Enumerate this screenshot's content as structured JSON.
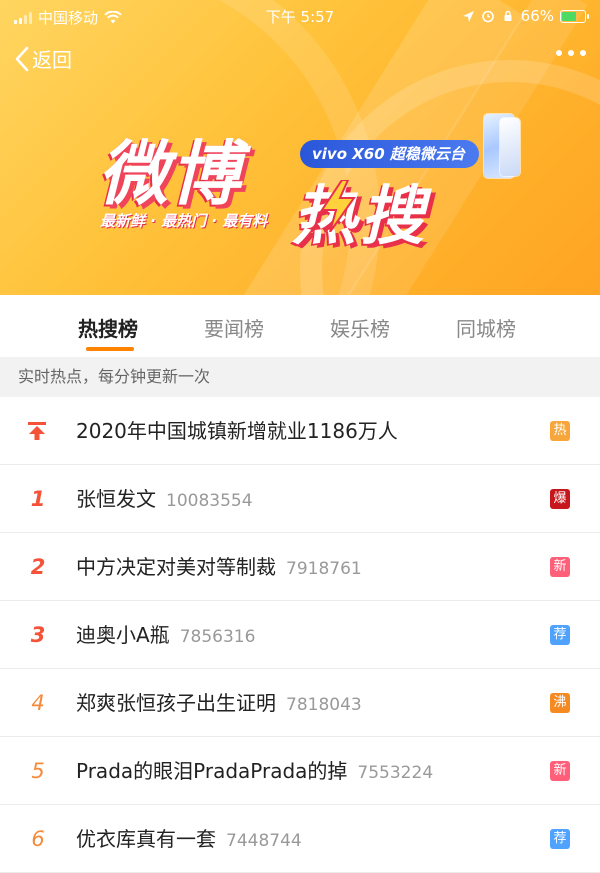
{
  "status_bar": {
    "carrier": "中国移动",
    "time": "下午 5:57",
    "battery": "66%",
    "battery_level": 0.66
  },
  "nav": {
    "back_label": "返回"
  },
  "banner": {
    "title_main": "微博",
    "title_hot": "热搜",
    "sponsor": "vivo X60 超稳微云台",
    "slogan": "最新鲜 · 最热门 · 最有料"
  },
  "tabs": [
    {
      "label": "热搜榜",
      "active": true
    },
    {
      "label": "要闻榜",
      "active": false
    },
    {
      "label": "娱乐榜",
      "active": false
    },
    {
      "label": "同城榜",
      "active": false
    }
  ],
  "subheader": "实时热点，每分钟更新一次",
  "colors": {
    "accent": "#ff8200",
    "rank_top": "#f4533a",
    "rank_mid": "#f68a3b",
    "badge_hot": "#f6a63a",
    "badge_boom": "#c6171c",
    "badge_new": "#ff5f78",
    "badge_rec": "#4fa3ff",
    "badge_boil": "#f58a22"
  },
  "list": [
    {
      "rank": "",
      "pinned": true,
      "title": "2020年中国城镇新增就业1186万人",
      "count": "",
      "badge": "热",
      "badge_color": "#f6a63a"
    },
    {
      "rank": "1",
      "pinned": false,
      "title": "张恒发文",
      "count": "10083554",
      "badge": "爆",
      "badge_color": "#c6171c"
    },
    {
      "rank": "2",
      "pinned": false,
      "title": "中方决定对美对等制裁",
      "count": "7918761",
      "badge": "新",
      "badge_color": "#ff5f78"
    },
    {
      "rank": "3",
      "pinned": false,
      "title": "迪奥小A瓶",
      "count": "7856316",
      "badge": "荐",
      "badge_color": "#4fa3ff"
    },
    {
      "rank": "4",
      "pinned": false,
      "title": "郑爽张恒孩子出生证明",
      "count": "7818043",
      "badge": "沸",
      "badge_color": "#f58a22"
    },
    {
      "rank": "5",
      "pinned": false,
      "title": "Prada的眼泪PradaPrada的掉",
      "count": "7553224",
      "badge": "新",
      "badge_color": "#ff5f78"
    },
    {
      "rank": "6",
      "pinned": false,
      "title": "优衣库真有一套",
      "count": "7448744",
      "badge": "荐",
      "badge_color": "#4fa3ff"
    }
  ]
}
